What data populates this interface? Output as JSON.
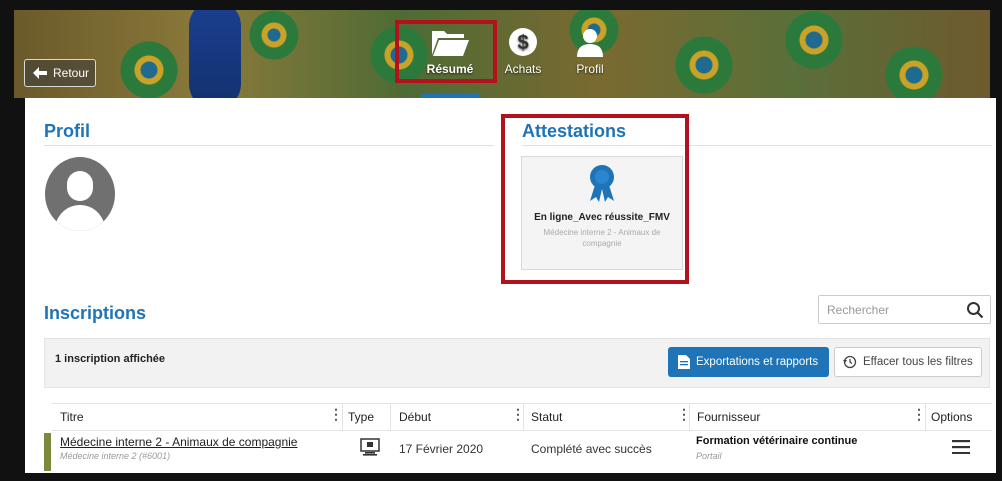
{
  "header": {
    "back_label": "Retour",
    "nav": [
      {
        "label": "Résumé",
        "icon": "folder-open-icon",
        "active": true
      },
      {
        "label": "Achats",
        "icon": "dollar-circle-icon",
        "active": false
      },
      {
        "label": "Profil",
        "icon": "user-icon",
        "active": false
      }
    ]
  },
  "profil": {
    "title": "Profil"
  },
  "attestations": {
    "title": "Attestations",
    "card": {
      "name": "En ligne_Avec réussite_FMV",
      "course": "Médecine interne 2 - Animaux de compagnie",
      "icon": "award-ribbon-icon"
    }
  },
  "inscriptions": {
    "title": "Inscriptions",
    "search_placeholder": "Rechercher",
    "count_label": "1 inscription affichée",
    "export_label": "Exportations et rapports",
    "clear_label": "Effacer tous les filtres",
    "columns": [
      "Titre",
      "Type",
      "Début",
      "Statut",
      "Fournisseur",
      "Options"
    ],
    "rows": [
      {
        "title": "Médecine interne 2 - Animaux de compagnie",
        "subtitle": "Médecine interne 2 (#6001)",
        "type_icon": "monitor-icon",
        "debut": "17 Février 2020",
        "statut": "Complété avec succès",
        "fournisseur": "Formation vétérinaire continue",
        "fournisseur_sub": "Portail"
      }
    ]
  },
  "colors": {
    "accent": "#1f73b7",
    "highlight": "#b3121c",
    "row_marker": "#7a8a3a"
  }
}
